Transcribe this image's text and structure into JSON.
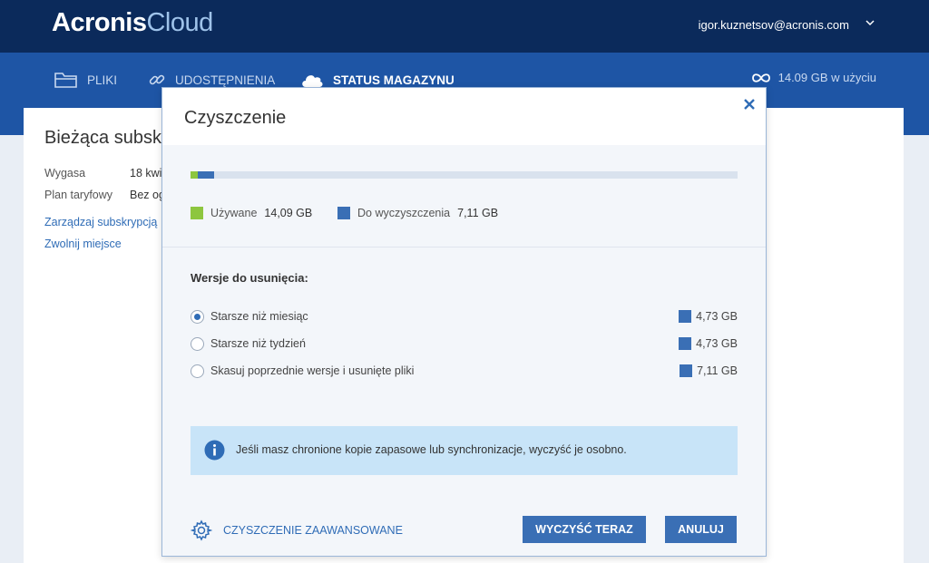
{
  "header": {
    "logo_brand": "Acronis",
    "logo_product": "Cloud",
    "user_email": "igor.kuznetsov@acronis.com",
    "colors": {
      "header_bg": "#0b2a5b",
      "nav_bg": "#1e55a5"
    }
  },
  "nav": {
    "items": [
      {
        "label": "PLIKI",
        "icon": "folder-icon",
        "active": false
      },
      {
        "label": "UDOSTĘPNIENIA",
        "icon": "link-icon",
        "active": false
      },
      {
        "label": "STATUS MAGAZYNU",
        "icon": "cloud-icon",
        "active": true
      }
    ],
    "usage_text": "14.09 GB w użyciu",
    "usage_icon": "infinity-icon"
  },
  "background_card": {
    "title": "Bieżąca subsk",
    "rows": [
      {
        "label": "Wygasa",
        "value": "18 kwi"
      },
      {
        "label": "Plan taryfowy",
        "value": "Bez og"
      }
    ],
    "links": [
      "Zarządzaj subskrypcją",
      "Zwolnij miejsce"
    ]
  },
  "dialog": {
    "title": "Czyszczenie",
    "close_icon": "close-icon",
    "usage_bar": {
      "used_fraction": 0.014,
      "clean_fraction": 0.03
    },
    "legend": [
      {
        "label": "Używane",
        "amount": "14,09 GB",
        "color": "#8dc63f"
      },
      {
        "label": "Do wyczyszczenia",
        "amount": "7,11 GB",
        "color": "#3a6fb5"
      }
    ],
    "section_title": "Wersje do usunięcia:",
    "options": [
      {
        "label": "Starsze niż miesiąc",
        "size": "4,73 GB",
        "checked": true
      },
      {
        "label": "Starsze niż tydzień",
        "size": "4,73 GB",
        "checked": false
      },
      {
        "label": "Skasuj poprzednie wersje i usunięte pliki",
        "size": "7,11 GB",
        "checked": false
      }
    ],
    "info_text": "Jeśli masz chronione kopie zapasowe lub synchronizacje, wyczyść je osobno.",
    "advanced_label": "CZYSZCZENIE ZAAWANSOWANE",
    "buttons": {
      "clean_now": "WYCZYŚĆ TERAZ",
      "cancel": "ANULUJ"
    }
  }
}
